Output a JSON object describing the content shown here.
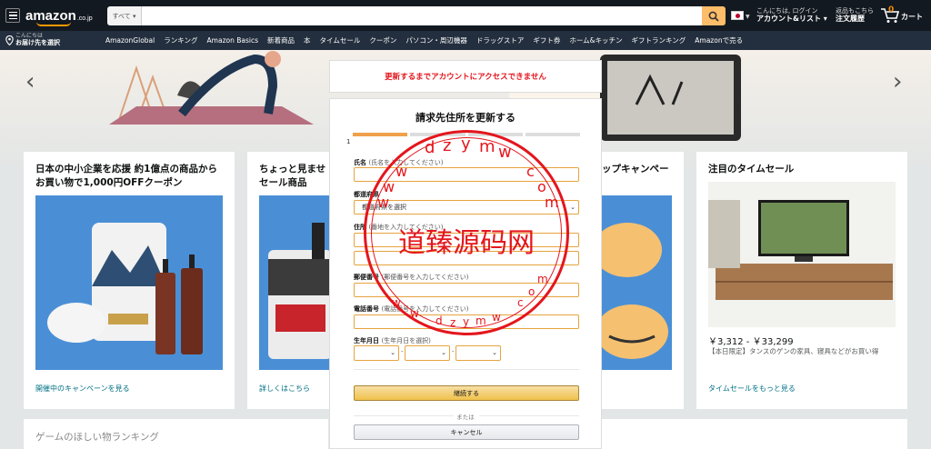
{
  "nav": {
    "logo_text": "amazon",
    "logo_tld": ".co.jp",
    "search_category": "すべて ▾",
    "search_value": "",
    "account_greeting": "こんにちは, ログイン",
    "account_label": "アカウント&リスト ▾",
    "orders_line1": "返品もこちら",
    "orders_line2": "注文履歴",
    "cart_count": "0",
    "cart_label": "カート",
    "deliver_line1": "こんにちは",
    "deliver_line2": "お届け先を選択",
    "sub_links": [
      "AmazonGlobal",
      "ランキング",
      "Amazon Basics",
      "新着商品",
      "本",
      "タイムセール",
      "クーポン",
      "パソコン・周辺機器",
      "ドラッグストア",
      "ギフト券",
      "ホーム&キッチン",
      "ギフトランキング",
      "Amazonで売る"
    ]
  },
  "hero": {
    "prev": "‹",
    "next": "›"
  },
  "cards": {
    "card1_title": "日本の中小企業を応援 約1億点の商品からお買い物で1,000円OFFクーポン",
    "card1_link": "開催中のキャンペーンを見る",
    "card2_title": "ちょっと見ませ\nセール商品",
    "card2_link": "詳しくはこちら",
    "card3_title": "ップキャンペー",
    "card4_title": "注目のタイムセール",
    "card4_price": "￥3,312 - ￥33,299",
    "card4_desc": "【本日限定】タンスのゲンの家具、寝具などがお買い得",
    "card4_link": "タイムセールをもっと見る",
    "bottom_title": "ゲームのほしい物ランキング"
  },
  "modal": {
    "warning": "更新するまでアカウントにアクセスできません",
    "title": "請求先住所を更新する",
    "step_num": "1",
    "name_label": "氏名",
    "name_hint": "(氏名を入力してください)",
    "pref_label": "都道府県",
    "pref_value": "都道府県を選択",
    "addr_label": "住所",
    "addr_hint": "(番地を入力してください)",
    "zip_label": "郵便番号",
    "zip_hint": "(郵便番号を入力してください)",
    "phone_label": "電話番号",
    "phone_hint": "(電話番号を入力してください)",
    "birth_label": "生年月日",
    "birth_hint": "(生年月日を選択)",
    "dash": "-",
    "continue_label": "継続する",
    "or_label": "または",
    "cancel_label": "キャンセル"
  },
  "stamp": {
    "text": "道臻源码网"
  },
  "colors": {
    "accent": "#febd69",
    "nav_bg": "#131921",
    "subnav_bg": "#232f3e",
    "warning": "#e4161d",
    "link": "#007185"
  }
}
